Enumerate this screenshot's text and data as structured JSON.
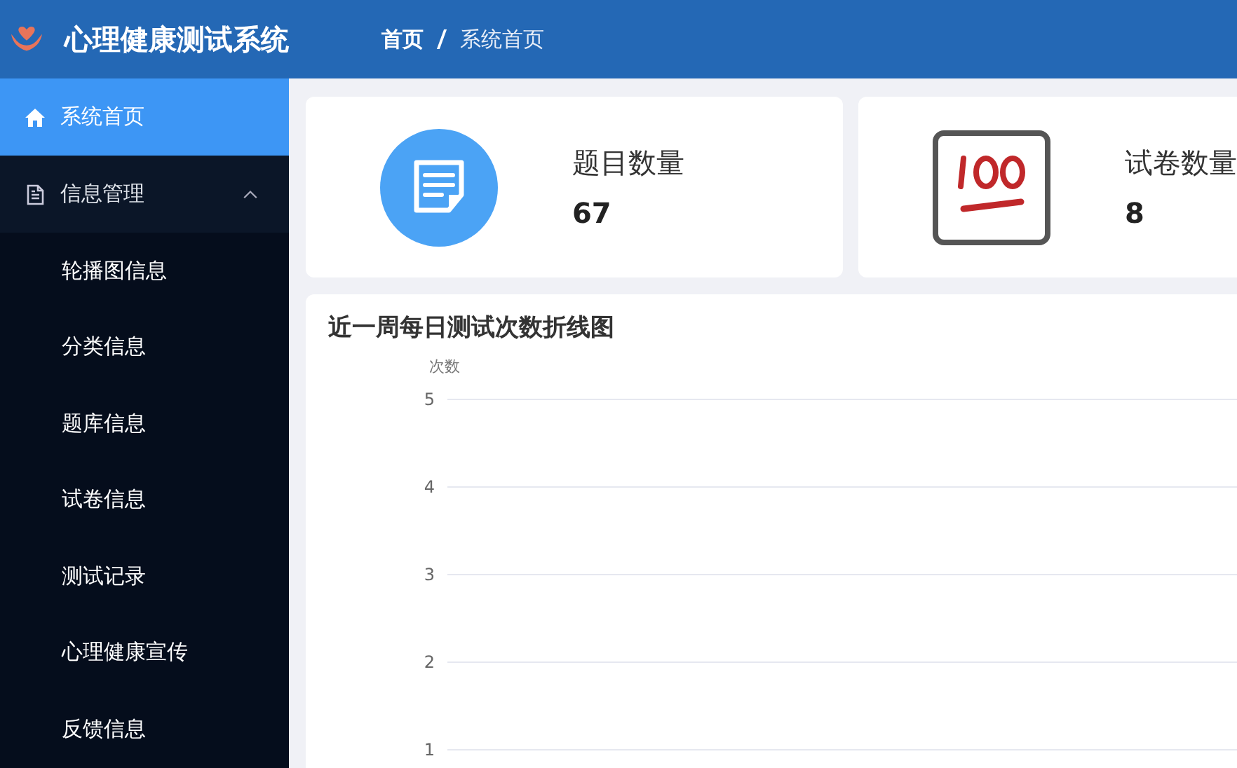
{
  "header": {
    "title": "心理健康测试系统",
    "breadcrumb": [
      "首页",
      "系统首页"
    ]
  },
  "sidebar": {
    "items": [
      {
        "label": "系统首页",
        "kind": "link",
        "selected": true
      },
      {
        "label": "信息管理",
        "kind": "group",
        "selected": false,
        "expanded": true,
        "children": [
          {
            "label": "轮播图信息",
            "selected": false
          },
          {
            "label": "分类信息",
            "selected": false
          },
          {
            "label": "题库信息",
            "selected": false
          },
          {
            "label": "试卷信息",
            "selected": false
          },
          {
            "label": "测试记录",
            "selected": false
          },
          {
            "label": "心理健康宣传",
            "selected": false
          },
          {
            "label": "反馈信息",
            "selected": false
          }
        ]
      }
    ]
  },
  "stats": [
    {
      "label": "题目数量",
      "value": "67",
      "kind": "note"
    },
    {
      "label": "试卷数量",
      "value": "8",
      "kind": "hundred"
    }
  ],
  "chart": {
    "title": "近一周每日测试次数折线图",
    "y_axis_title": "次数",
    "y_axis_ticks": [
      "5",
      "4",
      "3",
      "2",
      "1"
    ]
  }
}
